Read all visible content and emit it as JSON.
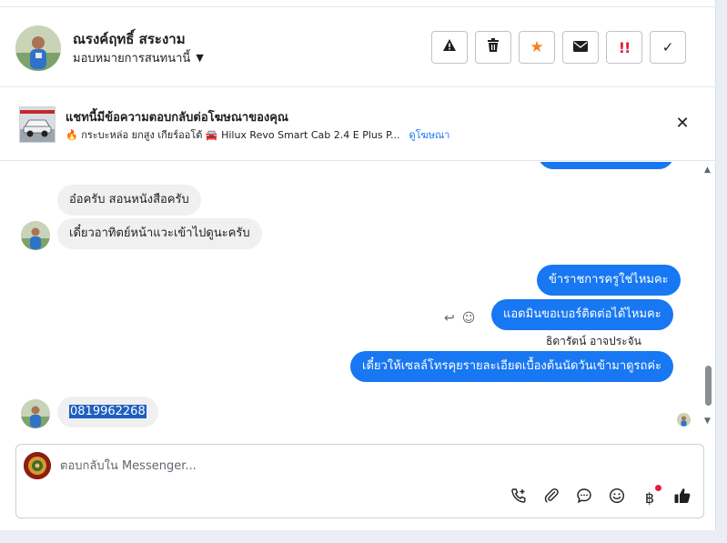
{
  "header": {
    "contact_name": "ณรงค์ฤทธิ์ สระงาม",
    "assign_label": "มอบหมายการสนทนานี้",
    "actions": [
      {
        "icon": "warning-icon",
        "glyph": "▲"
      },
      {
        "icon": "trash-icon",
        "glyph": "🗑"
      },
      {
        "icon": "star-icon",
        "glyph": "★",
        "color": "#f5821f"
      },
      {
        "icon": "mail-icon",
        "glyph": "✉"
      },
      {
        "icon": "priority-icon",
        "glyph": "!!",
        "color": "#e41e3f"
      },
      {
        "icon": "check-icon",
        "glyph": "✓"
      }
    ]
  },
  "ad_notice": {
    "title": "แชทนี้มีข้อความตอบกลับต่อโฆษณาของคุณ",
    "subtitle": "🔥 กระบะหล่อ ยกสูง เกียร์ออโต้ 🚘 Hilux Revo Smart Cab 2.4 E Plus P...",
    "link": "ดูโฆษณา"
  },
  "messages": {
    "m1": "อ๋อครับ สอนหนังสือครับ",
    "m2": "เดี๋ยวอาทิตย์หน้าแวะเข้าไปดูนะครับ",
    "m3": "ข้าราชการครูใช่ไหมคะ",
    "m4": "แอดมินขอเบอร์ติดต่อได้ไหมคะ",
    "sender": "ธิดารัตน์ อาจประจัน",
    "m5": "เดี๋ยวให้เซลล์โทรคุยรายละเอียดเบื้องต้นนัดวันเข้ามาดูรถค่ะ",
    "m6": "0819962268"
  },
  "composer": {
    "placeholder": "ตอบกลับใน Messenger..."
  },
  "colors": {
    "accent": "#1877f2",
    "incoming_bubble": "#f0f0f0",
    "notification_dot": "#e41e3f"
  }
}
